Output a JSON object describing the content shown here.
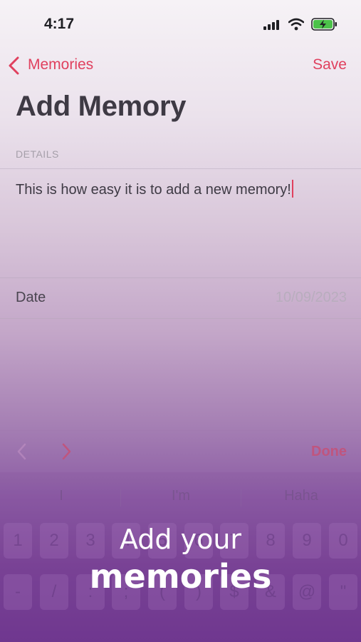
{
  "status_bar": {
    "time": "4:17"
  },
  "nav": {
    "back_label": "Memories",
    "save_label": "Save"
  },
  "page": {
    "title": "Add Memory"
  },
  "details": {
    "header": "DETAILS",
    "text": "This is how easy it is to add a new memory!"
  },
  "date_row": {
    "label": "Date",
    "value": "10/09/2023"
  },
  "toolbar": {
    "done_label": "Done"
  },
  "keyboard": {
    "suggestions": [
      "I",
      "I'm",
      "Haha"
    ],
    "row1": [
      "1",
      "2",
      "3",
      "4",
      "5",
      "6",
      "7",
      "8",
      "9",
      "0"
    ],
    "row2": [
      "-",
      "/",
      ":",
      ";",
      "(",
      ")",
      "$",
      "&",
      "@",
      "\""
    ]
  },
  "caption": {
    "line1": "Add your",
    "line2": "memories"
  },
  "colors": {
    "accent": "#e0405e",
    "done": "#c0557e"
  }
}
